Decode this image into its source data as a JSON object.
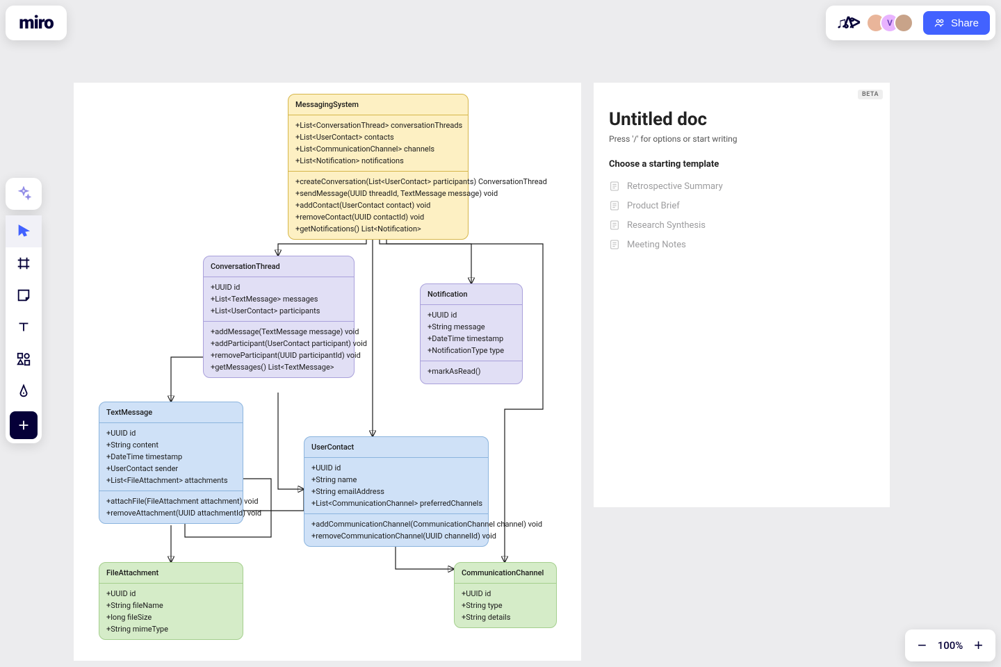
{
  "logo": "miro",
  "share_label": "Share",
  "zoom_level": "100%",
  "doc": {
    "beta": "BETA",
    "title": "Untitled doc",
    "hint": "Press '/' for options or start writing",
    "templates_heading": "Choose a starting template",
    "templates": [
      {
        "label": "Retrospective Summary"
      },
      {
        "label": "Product Brief"
      },
      {
        "label": "Research Synthesis"
      },
      {
        "label": "Meeting Notes"
      }
    ]
  },
  "avatars": [
    {
      "bg": "#e9b59a",
      "text": ""
    },
    {
      "bg": "#e8b3ff",
      "text": "V"
    },
    {
      "bg": "#c8a389",
      "text": ""
    }
  ],
  "uml": {
    "MessagingSystem": {
      "name": "MessagingSystem",
      "attrs": [
        "+List<ConversationThread> conversationThreads",
        "+List<UserContact> contacts",
        "+List<CommunicationChannel> channels",
        "+List<Notification> notifications"
      ],
      "ops": [
        "+createConversation(List<UserContact> participants) ConversationThread",
        "+sendMessage(UUID threadId, TextMessage message) void",
        "+addContact(UserContact contact) void",
        "+removeContact(UUID contactId) void",
        "+getNotifications() List<Notification>"
      ]
    },
    "ConversationThread": {
      "name": "ConversationThread",
      "attrs": [
        "+UUID id",
        "+List<TextMessage> messages",
        "+List<UserContact> participants"
      ],
      "ops": [
        "+addMessage(TextMessage message) void",
        "+addParticipant(UserContact participant) void",
        "+removeParticipant(UUID participantId) void",
        "+getMessages() List<TextMessage>"
      ]
    },
    "Notification": {
      "name": "Notification",
      "attrs": [
        "+UUID id",
        "+String message",
        "+DateTime timestamp",
        "+NotificationType type"
      ],
      "ops": [
        "+markAsRead()"
      ]
    },
    "TextMessage": {
      "name": "TextMessage",
      "attrs": [
        "+UUID id",
        "+String content",
        "+DateTime timestamp",
        "+UserContact sender",
        "+List<FileAttachment> attachments"
      ],
      "ops": [
        "+attachFile(FileAttachment attachment) void",
        "+removeAttachment(UUID attachmentId) void"
      ]
    },
    "UserContact": {
      "name": "UserContact",
      "attrs": [
        "+UUID id",
        "+String name",
        "+String emailAddress",
        "+List<CommunicationChannel> preferredChannels"
      ],
      "ops": [
        "+addCommunicationChannel(CommunicationChannel channel) void",
        "+removeCommunicationChannel(UUID channelId) void"
      ]
    },
    "FileAttachment": {
      "name": "FileAttachment",
      "attrs": [
        "+UUID id",
        "+String fileName",
        "+long fileSize",
        "+String mimeType"
      ],
      "ops": []
    },
    "CommunicationChannel": {
      "name": "CommunicationChannel",
      "attrs": [
        "+UUID id",
        "+String type",
        "+String details"
      ],
      "ops": []
    }
  }
}
